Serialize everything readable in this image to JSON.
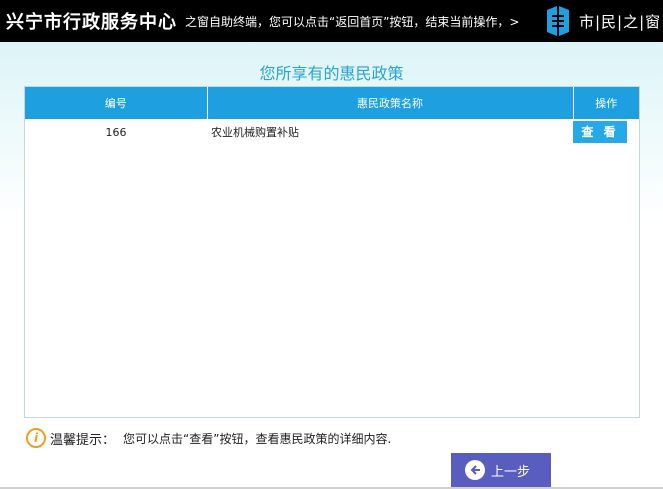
{
  "header": {
    "title": "兴宁市行政服务中心",
    "marquee": "之窗自助终端，您可以点击“返回首页”按钮，结束当前操作，>",
    "logo_text": "市|民|之|窗",
    "logo_icon": "window-logo-icon"
  },
  "page": {
    "title": "您所享有的惠民政策"
  },
  "table": {
    "columns": [
      "编号",
      "惠民政策名称",
      "操作"
    ],
    "rows": [
      {
        "id": "166",
        "name": "农业机械购置补贴",
        "action": "查 看"
      }
    ]
  },
  "tip": {
    "icon": "info-icon",
    "label": "温馨提示：",
    "text": "您可以点击“查看”按钮，查看惠民政策的详细内容."
  },
  "nav": {
    "back_label": "上一步",
    "back_icon": "arrow-left-icon"
  },
  "colors": {
    "header_bg": "#000000",
    "table_header": "#1ea0e0",
    "view_button": "#25a9e8",
    "back_button": "#5a5dc0",
    "title_color": "#2aa3d6",
    "tip_icon": "#f0a020"
  }
}
